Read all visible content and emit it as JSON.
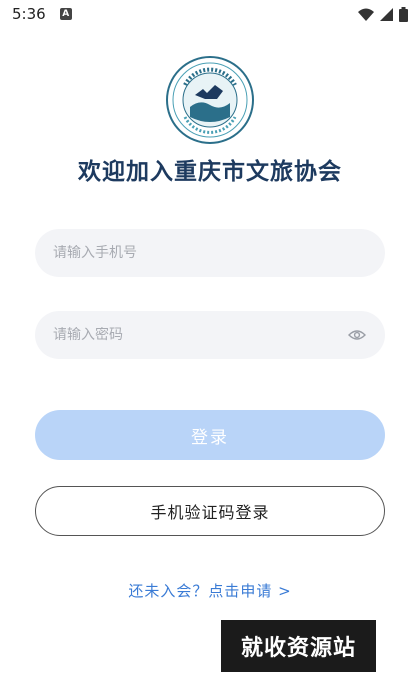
{
  "status_bar": {
    "time": "5:36",
    "notification_icon": "a-notification-icon",
    "icons": [
      "wifi-icon",
      "signal-icon",
      "battery-icon"
    ]
  },
  "logo": {
    "text": "重庆市文化和旅游协会 Chongqing Culture and Tourism Association"
  },
  "title": "欢迎加入重庆市文旅协会",
  "phone_field": {
    "placeholder": "请输入手机号",
    "value": ""
  },
  "password_field": {
    "placeholder": "请输入密码",
    "value": "",
    "icon": "eye-icon"
  },
  "login_button": {
    "label": "登录"
  },
  "sms_login_button": {
    "label": "手机验证码登录"
  },
  "register_link": {
    "label": "还未入会？点击申请 >"
  },
  "watermark": {
    "text": "就收资源站"
  },
  "colors": {
    "title": "#1d3a5f",
    "login_button_bg": "#b9d4f8",
    "link": "#3a7bd5",
    "field_bg": "#f3f4f7"
  }
}
